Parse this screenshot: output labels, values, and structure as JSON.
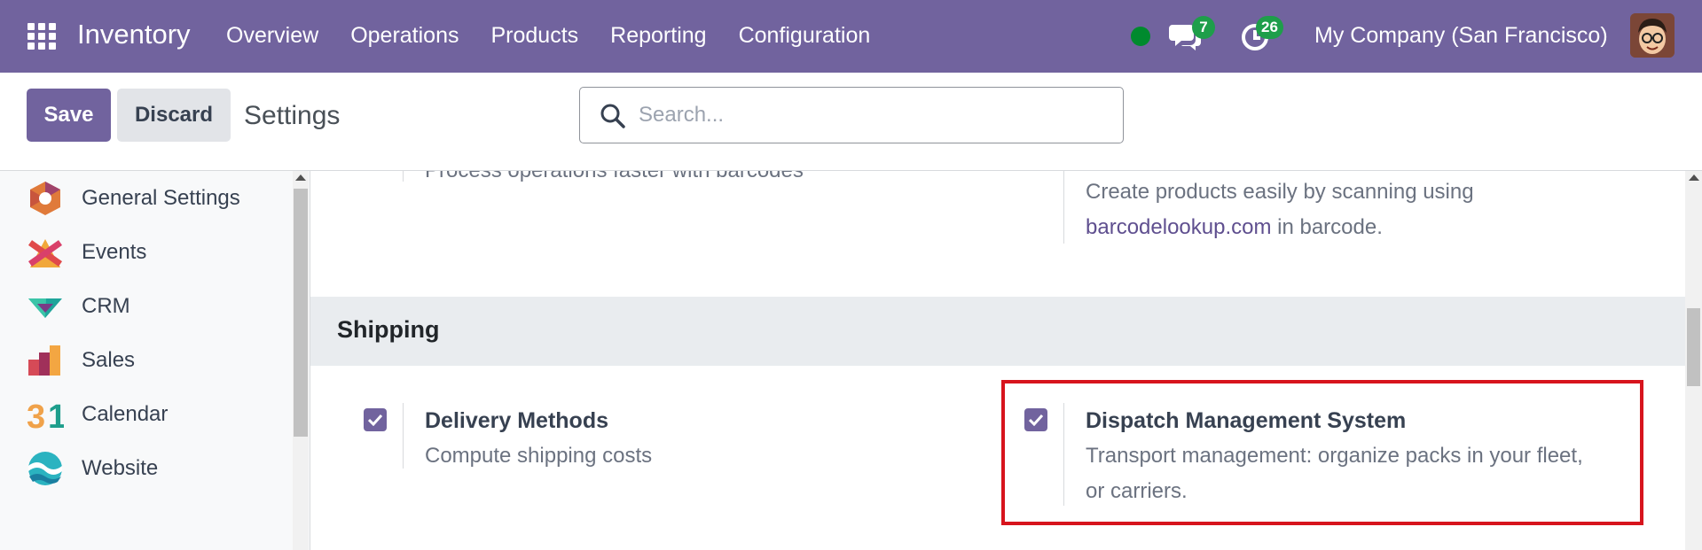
{
  "navbar": {
    "brand": "Inventory",
    "menu": [
      "Overview",
      "Operations",
      "Products",
      "Reporting",
      "Configuration"
    ],
    "messages_count": "7",
    "activities_count": "26",
    "company": "My Company (San Francisco)",
    "bg_color": "#71639e"
  },
  "control": {
    "save_label": "Save",
    "discard_label": "Discard",
    "breadcrumb": "Settings",
    "search_placeholder": "Search..."
  },
  "sidebar": {
    "items": [
      {
        "label": "General Settings",
        "icon": "general-settings-icon"
      },
      {
        "label": "Events",
        "icon": "events-icon"
      },
      {
        "label": "CRM",
        "icon": "crm-icon"
      },
      {
        "label": "Sales",
        "icon": "sales-icon"
      },
      {
        "label": "Calendar",
        "icon": "calendar-icon"
      },
      {
        "label": "Website",
        "icon": "website-icon"
      }
    ]
  },
  "main": {
    "barcode_cut_text": "Process operations faster with barcodes",
    "barcode_lookup": {
      "desc_line1": "Create products easily by scanning using",
      "link": "barcodelookup.com",
      "desc_tail": " in barcode."
    },
    "section_title": "Shipping",
    "options": [
      {
        "title": "Delivery Methods",
        "desc": "Compute shipping costs",
        "checked": true
      },
      {
        "title": "Dispatch Management System",
        "desc_line1": "Transport management: organize packs in your fleet,",
        "desc_line2": "or carriers.",
        "checked": true,
        "highlighted": true
      }
    ],
    "highlight_color": "#d7141d"
  }
}
